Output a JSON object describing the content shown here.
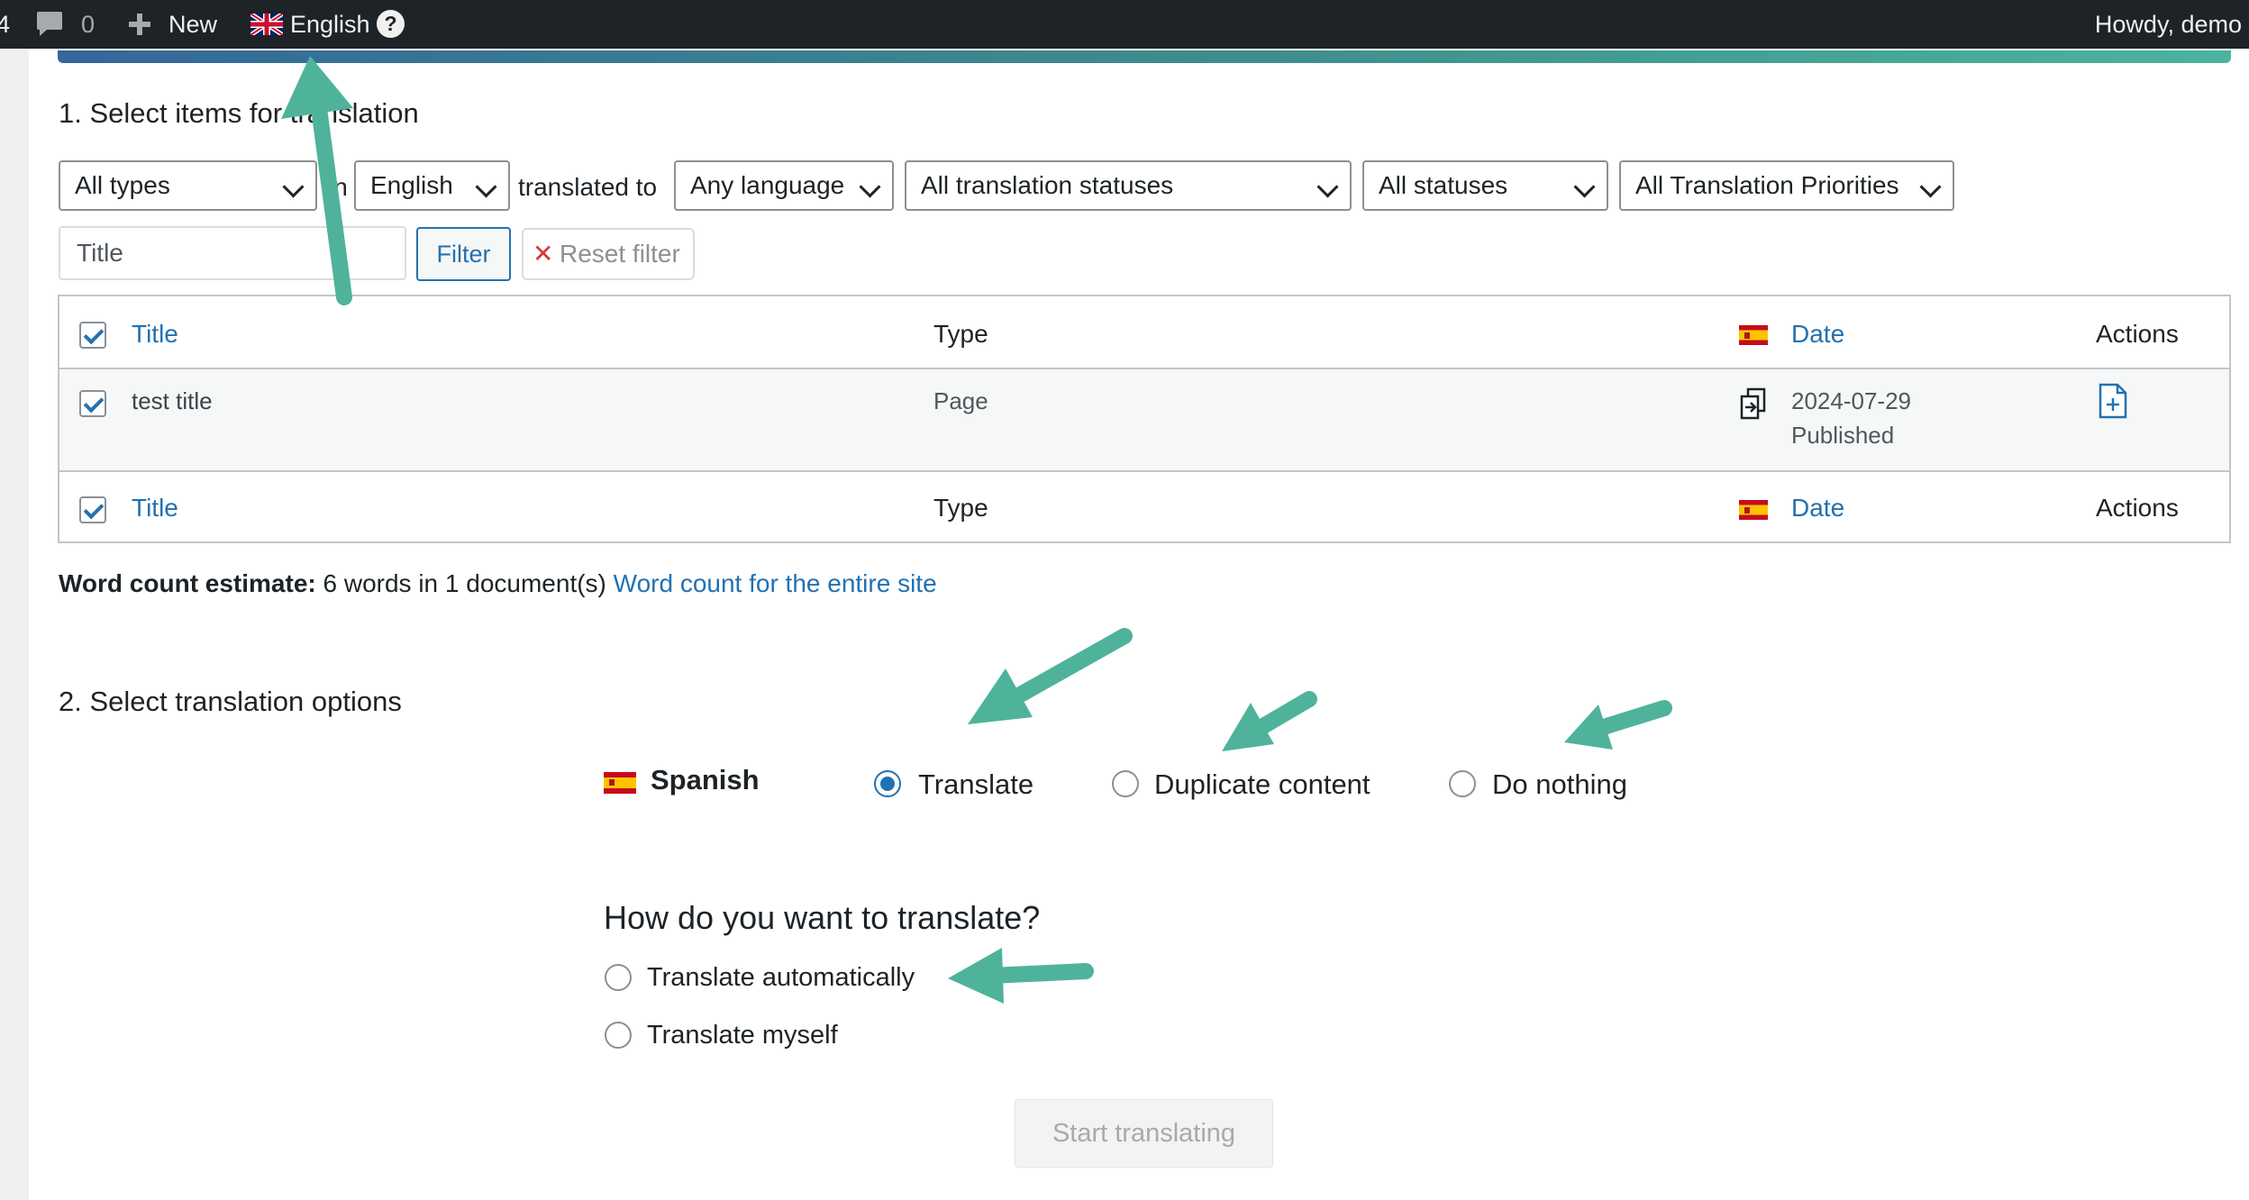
{
  "adminbar": {
    "left_count": "4",
    "comments_count": "0",
    "new_label": "New",
    "language_label": "English",
    "help_label": "?",
    "greeting": "Howdy, demo"
  },
  "section1": {
    "heading": "1. Select items for translation",
    "filters": {
      "type": "All types",
      "in_label": "in",
      "source_language": "English",
      "translated_to_label": "translated to",
      "target_language": "Any language",
      "translation_status": "All translation statuses",
      "status": "All statuses",
      "priority": "All Translation Priorities"
    },
    "title_placeholder": "Title",
    "filter_button": "Filter",
    "reset_button": "Reset filter"
  },
  "table": {
    "columns": {
      "title": "Title",
      "type": "Type",
      "date": "Date",
      "actions": "Actions"
    },
    "rows": [
      {
        "title": "test title",
        "type": "Page",
        "date": "2024-07-29",
        "status": "Published",
        "checked": true
      }
    ]
  },
  "word_count": {
    "label": "Word count estimate:",
    "text": "6 words in 1 document(s)",
    "link": "Word count for the entire site"
  },
  "section2": {
    "heading": "2. Select translation options",
    "language": "Spanish",
    "options": [
      "Translate",
      "Duplicate content",
      "Do nothing"
    ],
    "selected_option": "Translate",
    "how_heading": "How do you want to translate?",
    "methods": [
      "Translate automatically",
      "Translate myself"
    ],
    "start_button": "Start translating"
  },
  "colors": {
    "accent": "#2271b1",
    "adminbar": "#1d2327",
    "annotation_arrow": "#4fb39b"
  },
  "icons": [
    "comment-icon",
    "plus-icon",
    "uk-flag-icon",
    "help-icon",
    "spain-flag-icon",
    "translation-status-icon",
    "add-translation-icon"
  ]
}
